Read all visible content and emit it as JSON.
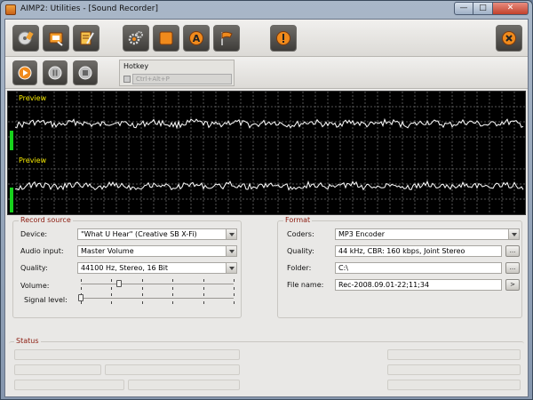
{
  "window": {
    "title": "AIMP2: Utilities - [Sound Recorder]",
    "controls": {
      "minimize": "—",
      "maximize": "□",
      "close": "✕"
    }
  },
  "toolbar": {
    "tools": [
      {
        "icon": "cd-search-icon"
      },
      {
        "icon": "tag-editor-icon"
      },
      {
        "icon": "notepad-icon"
      },
      {
        "icon": "gears-icon"
      },
      {
        "icon": "orange-square-icon"
      },
      {
        "icon": "audio-converter-icon"
      },
      {
        "icon": "flag-icon"
      },
      {
        "icon": "info-icon"
      }
    ],
    "close_icon": "close-circle-icon"
  },
  "recorder": {
    "record_icon": "record-icon",
    "pause_icon": "pause-icon",
    "stop_icon": "stop-icon",
    "hotkey": {
      "label": "Hotkey",
      "value": "Ctrl+Alt+P"
    }
  },
  "preview": {
    "top_label": "Preview",
    "bottom_label": "Preview",
    "vu_color": "#17d21c",
    "label_color": "#f4e800"
  },
  "record_source": {
    "title": "Record source",
    "device_label": "Device:",
    "device_value": "\"What U Hear\" (Creative SB X-Fi)",
    "input_label": "Audio input:",
    "input_value": "Master Volume",
    "quality_label": "Quality:",
    "quality_value": "44100 Hz, Stereo, 16 Bit",
    "volume_label": "Volume:",
    "signal_label": "Signal level:",
    "volume_level": 0.25,
    "signal_level": 0.0
  },
  "format": {
    "title": "Format",
    "coders_label": "Coders:",
    "coders_value": "MP3 Encoder",
    "quality_label": "Quality:",
    "quality_value": "44 kHz, CBR: 160 kbps, Joint Stereo",
    "quality_button": "...",
    "folder_label": "Folder:",
    "folder_value": "C:\\",
    "folder_button": "...",
    "filename_label": "File name:",
    "filename_value": "Rec-2008.09.01-22;11;34",
    "filename_button": ">"
  },
  "status": {
    "title": "Status"
  },
  "colors": {
    "group_title": "#8b1a0e",
    "accent_orange": "#f08a1c"
  }
}
